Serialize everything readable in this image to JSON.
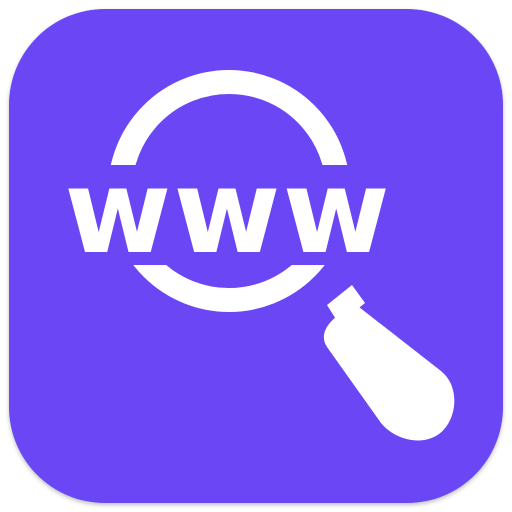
{
  "icon": {
    "label": "www",
    "background_color": "#6b46f5",
    "foreground_color": "#ffffff",
    "glyph": "magnifying-glass-icon"
  }
}
